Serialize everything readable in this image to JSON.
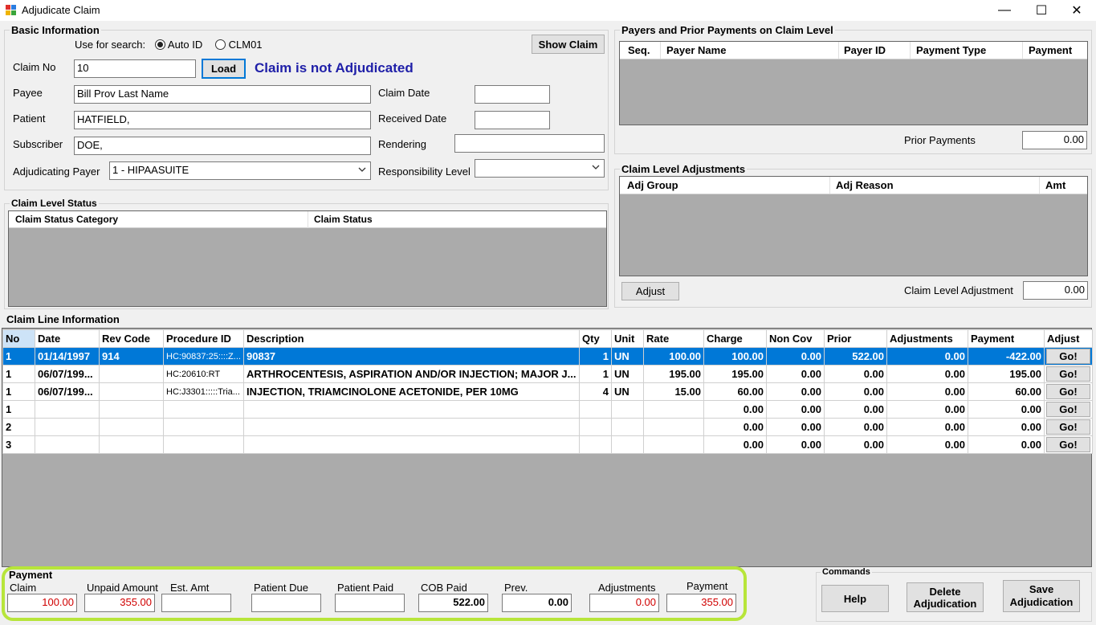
{
  "window": {
    "title": "Adjudicate Claim",
    "minimize": "—",
    "maximize": "☐",
    "close": "✕"
  },
  "basic": {
    "group_label": "Basic Information",
    "use_for_search": "Use for search:",
    "radio_auto": "Auto ID",
    "radio_clm": "CLM01",
    "show_claim": "Show Claim",
    "claim_no_label": "Claim No",
    "claim_no": "10",
    "load": "Load",
    "status_msg": "Claim is not Adjudicated",
    "payee_label": "Payee",
    "payee": "Bill Prov Last Name",
    "patient_label": "Patient",
    "patient": "HATFIELD,",
    "subscriber_label": "Subscriber",
    "subscriber": "DOE,",
    "adj_payer_label": "Adjudicating Payer",
    "adj_payer": "1 - HIPAASUITE",
    "claim_date_label": "Claim Date",
    "claim_date": "",
    "received_date_label": "Received Date",
    "received_date": "",
    "rendering_label": "Rendering",
    "rendering": "",
    "resp_level_label": "Responsibility Level",
    "resp_level": ""
  },
  "claim_status": {
    "group_label": "Claim Level Status",
    "col1": "Claim Status Category",
    "col2": "Claim Status"
  },
  "payers": {
    "group_label": "Payers and Prior Payments on Claim Level",
    "cols": [
      "Seq.",
      "Payer Name",
      "Payer ID",
      "Payment Type",
      "Payment"
    ],
    "prior_label": "Prior Payments",
    "prior_value": "0.00"
  },
  "adjustments": {
    "group_label": "Claim Level Adjustments",
    "cols": [
      "Adj Group",
      "Adj Reason",
      "Amt"
    ],
    "adjust_button": "Adjust",
    "cla_label": "Claim Level Adjustment",
    "cla_value": "0.00"
  },
  "lines": {
    "group_label": "Claim Line Information",
    "headers": [
      "No",
      "Date",
      "Rev Code",
      "Procedure ID",
      "Description",
      "Qty",
      "Unit",
      "Rate",
      "Charge",
      "Non Cov",
      "Prior",
      "Adjustments",
      "Payment",
      "Adjust"
    ],
    "rows": [
      [
        "1",
        "01/14/1997",
        "914",
        "HC:90837:25::::Z...",
        "90837",
        "1",
        "UN",
        "100.00",
        "100.00",
        "0.00",
        "522.00",
        "0.00",
        "-422.00",
        "Go!"
      ],
      [
        "1",
        "06/07/199...",
        "",
        "HC:20610:RT",
        "ARTHROCENTESIS, ASPIRATION AND/OR INJECTION; MAJOR J...",
        "1",
        "UN",
        "195.00",
        "195.00",
        "0.00",
        "0.00",
        "0.00",
        "195.00",
        "Go!"
      ],
      [
        "1",
        "06/07/199...",
        "",
        "HC:J3301:::::Tria...",
        "INJECTION, TRIAMCINOLONE ACETONIDE, PER 10MG",
        "4",
        "UN",
        "15.00",
        "60.00",
        "0.00",
        "0.00",
        "0.00",
        "60.00",
        "Go!"
      ],
      [
        "1",
        "",
        "",
        "",
        "",
        "",
        "",
        "",
        "0.00",
        "0.00",
        "0.00",
        "0.00",
        "0.00",
        "Go!"
      ],
      [
        "2",
        "",
        "",
        "",
        "",
        "",
        "",
        "",
        "0.00",
        "0.00",
        "0.00",
        "0.00",
        "0.00",
        "Go!"
      ],
      [
        "3",
        "",
        "",
        "",
        "",
        "",
        "",
        "",
        "0.00",
        "0.00",
        "0.00",
        "0.00",
        "0.00",
        "Go!"
      ]
    ]
  },
  "payment": {
    "group_label": "Payment",
    "claim_label": "Claim",
    "claim": "100.00",
    "unpaid_label": "Unpaid Amount",
    "unpaid": "355.00",
    "est_label": "Est. Amt",
    "est": "",
    "pdue_label": "Patient Due",
    "pdue": "",
    "ppaid_label": "Patient Paid",
    "ppaid": "",
    "cob_label": "COB Paid",
    "cob": "522.00",
    "prev_label": "Prev.",
    "prev": "0.00",
    "adj_label": "Adjustments",
    "adj": "0.00",
    "pay_label": "Payment",
    "pay": "355.00"
  },
  "commands": {
    "group_label": "Commands",
    "help": "Help",
    "delete_l1": "Delete",
    "delete_l2": "Adjudication",
    "save_l1": "Save",
    "save_l2": "Adjudication"
  },
  "colors": {
    "selection": "#0078d7",
    "status_text": "#1f1fa8",
    "amount_red": "#d00000",
    "highlight": "#b7e53a"
  }
}
